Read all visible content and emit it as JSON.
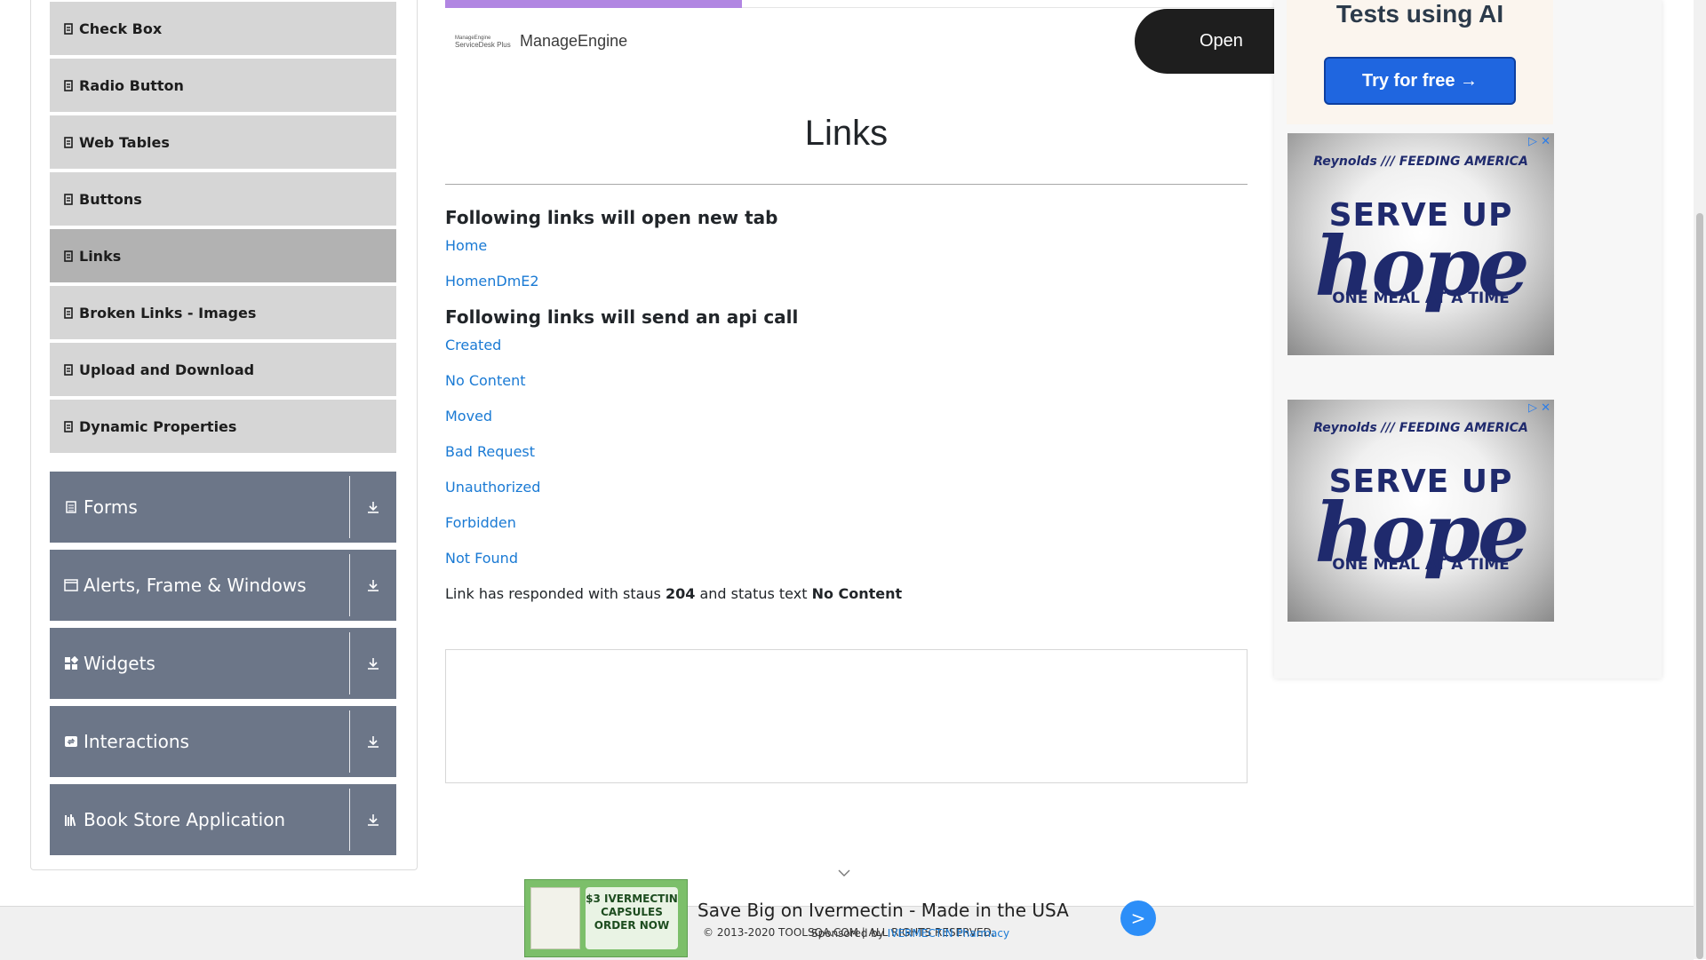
{
  "sidebar": {
    "items": [
      {
        "label": "Check Box"
      },
      {
        "label": "Radio Button"
      },
      {
        "label": "Web Tables"
      },
      {
        "label": "Buttons"
      },
      {
        "label": "Links"
      },
      {
        "label": "Broken Links - Images"
      },
      {
        "label": "Upload and Download"
      },
      {
        "label": "Dynamic Properties"
      }
    ],
    "active_item": "Links",
    "groups": [
      {
        "label": "Forms"
      },
      {
        "label": "Alerts, Frame & Windows"
      },
      {
        "label": "Widgets"
      },
      {
        "label": "Interactions"
      },
      {
        "label": "Book Store Application"
      }
    ]
  },
  "top_ad": {
    "brand": "ManageEngine",
    "logo_text": "ServiceDesk Plus",
    "open_label": "Open"
  },
  "main": {
    "title": "Links",
    "new_tab_heading": "Following links will open new tab",
    "new_tab_links": [
      "Home",
      "HomenDmE2"
    ],
    "api_heading": "Following links will send an api call",
    "api_links": [
      "Created",
      "No Content",
      "Moved",
      "Bad Request",
      "Unauthorized",
      "Forbidden",
      "Not Found"
    ],
    "response": {
      "prefix": "Link has responded with staus ",
      "status": "204",
      "middle": " and status text ",
      "status_text": "No Content"
    }
  },
  "right_ads": {
    "ai_title": "Tests using AI",
    "ai_button": "Try for free →",
    "hope_brands": "Reynolds /// FEEDING AMERICA",
    "hope_serve": "SERVE UP",
    "hope_word": "hope",
    "hope_meal": "ONE MEAL AT A TIME"
  },
  "bottom_ad": {
    "title": "Save Big on Ivermectin - Made in the USA",
    "img_text": "$3 IVERMECTIN CAPSULES ORDER NOW",
    "sponsor_prefix": "Sponsored by ",
    "sponsor_name": "IVERMECTIN Pharmacy",
    "button": ">"
  },
  "footer": {
    "copyright": "© 2013-2020 TOOLSQA.COM | ALL RIGHTS RESERVED."
  },
  "colors": {
    "menu_bg": "#d6d6d6",
    "menu_active_bg": "#b2b2b2",
    "group_bg": "#6c7688",
    "link": "#1a7ad4"
  }
}
